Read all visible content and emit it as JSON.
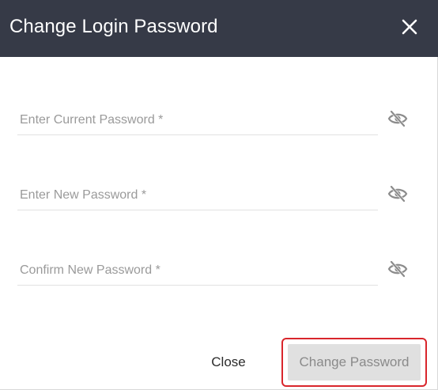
{
  "dialog": {
    "title": "Change Login Password",
    "close_icon": "close-icon"
  },
  "fields": [
    {
      "placeholder": "Enter Current Password *",
      "value": "",
      "toggle_icon": "eye-slash-icon"
    },
    {
      "placeholder": "Enter New Password *",
      "value": "",
      "toggle_icon": "eye-slash-icon"
    },
    {
      "placeholder": "Confirm New Password *",
      "value": "",
      "toggle_icon": "eye-slash-icon"
    }
  ],
  "actions": {
    "close_label": "Close",
    "submit_label": "Change Password",
    "submit_disabled": true
  },
  "colors": {
    "header_bg": "#363a47",
    "highlight_border": "#d9262c",
    "disabled_button_bg": "#e0e0e0"
  }
}
